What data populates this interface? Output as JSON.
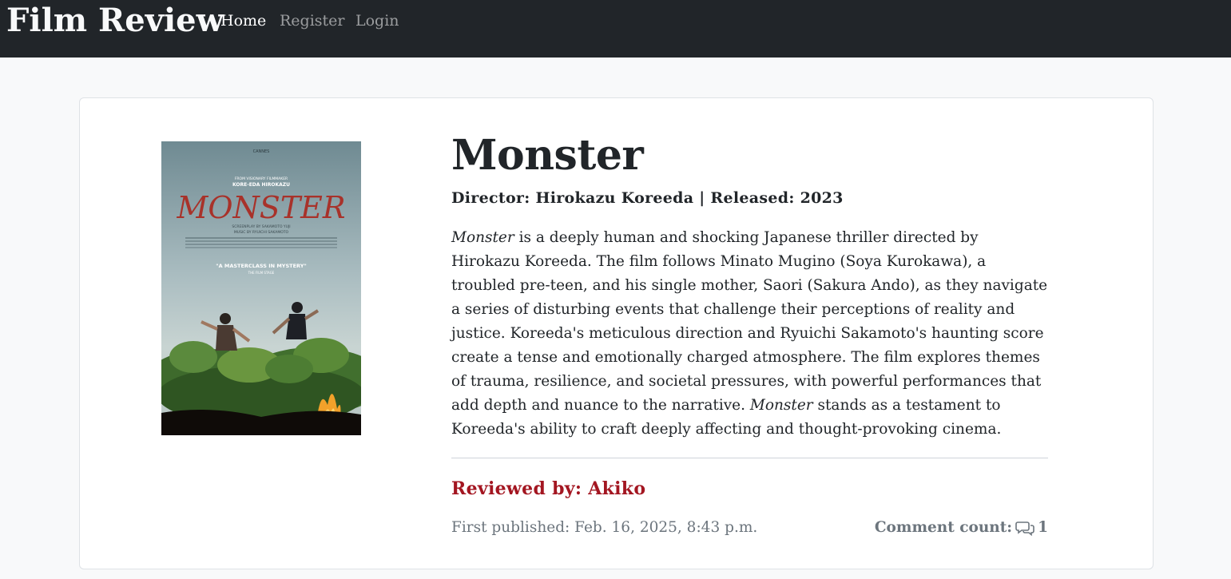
{
  "nav": {
    "brand": "Film Review",
    "links": [
      "Home",
      "Register",
      "Login"
    ]
  },
  "post": {
    "title": "Monster",
    "subtitle": "Director: Hirokazu Koreeda | Released: 2023",
    "desc_italic_1": "Monster",
    "desc_part_1": " is a deeply human and shocking Japanese thriller directed by Hirokazu Koreeda. The film follows Minato Mugino (Soya Kurokawa), a troubled pre-teen, and his single mother, Saori (Sakura Ando), as they navigate a series of disturbing events that challenge their perceptions of reality and justice. Koreeda's meticulous direction and Ryuichi Sakamoto's haunting score create a tense and emotionally charged atmosphere. The film explores themes of trauma, resilience, and societal pressures, with powerful performances that add depth and nuance to the narrative. ",
    "desc_italic_2": "Monster",
    "desc_part_2": " stands as a testament to Koreeda's ability to craft deeply affecting and thought-provoking cinema.",
    "reviewer": "Reviewed by: Akiko",
    "published": "First published: Feb. 16, 2025, 8:43 p.m.",
    "comment_label": "Comment count:",
    "comment_count": "1",
    "poster": {
      "festival": "CANNES",
      "tag": "FROM VISIONARY FILMMAKER",
      "director": "KORE-EDA HIROKAZU",
      "title": "MONSTER",
      "screenplay": "SCREENPLAY BY SAKAMOTO YUJI",
      "music": "MUSIC BY RYUICHI SAKAMOTO",
      "quote": "\"A MASTERCLASS IN MYSTERY\"",
      "source": "THE FILM STAGE"
    }
  },
  "colors": {
    "navbar": "#212529",
    "reviewer": "#a31621",
    "muted": "#6c757d"
  }
}
